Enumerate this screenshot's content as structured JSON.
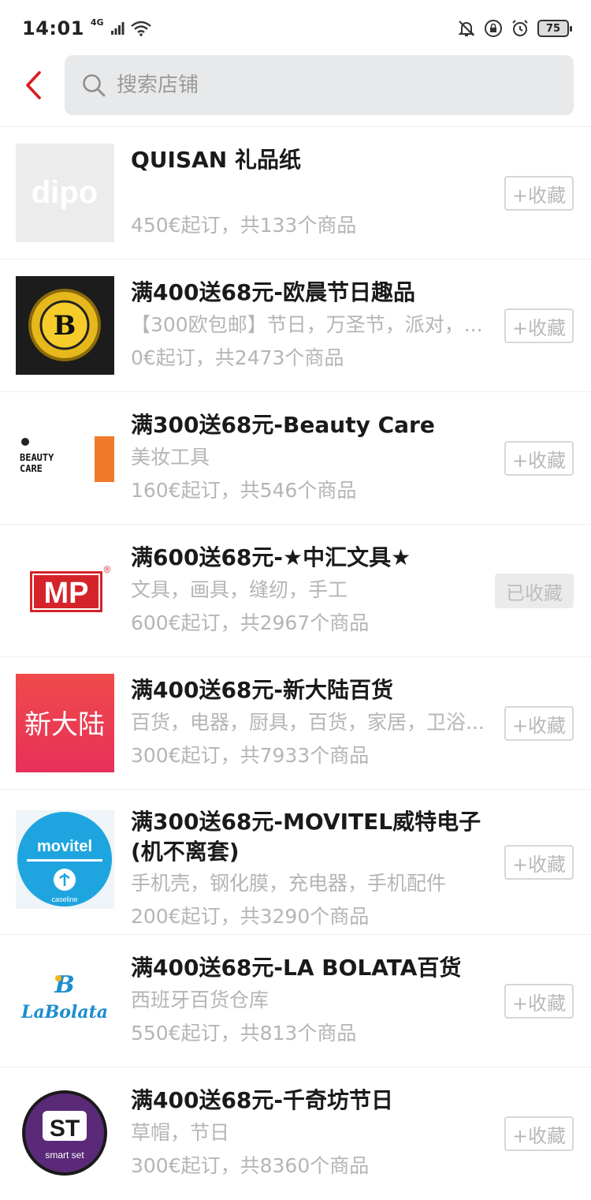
{
  "status": {
    "time": "14:01",
    "network": "4G",
    "battery": "75"
  },
  "search": {
    "placeholder": "搜索店铺"
  },
  "shops": [
    {
      "name": "QUISAN 礼品纸",
      "desc": "",
      "meta": "450€起订，共133个商品",
      "fav_label": "+收藏",
      "favorited": false,
      "logo_text": "dipo"
    },
    {
      "name": "满400送68元-欧晨节日趣品",
      "desc": "【300欧包邮】节日，万圣节，派对，...",
      "meta": "0€起订，共2473个商品",
      "fav_label": "+收藏",
      "favorited": false,
      "logo_text": "B"
    },
    {
      "name": "满300送68元-Beauty Care",
      "desc": "美妆工具",
      "meta": "160€起订，共546个商品",
      "fav_label": "+收藏",
      "favorited": false,
      "logo_text": "BEAUTY CARE"
    },
    {
      "name": "满600送68元-★中汇文具★",
      "desc": "文具，画具，缝纫，手工",
      "meta": "600€起订，共2967个商品",
      "fav_label": "已收藏",
      "favorited": true,
      "logo_text": "MP"
    },
    {
      "name": "满400送68元-新大陆百货",
      "desc": "百货，电器，厨具，百货，家居，卫浴...",
      "meta": "300€起订，共7933个商品",
      "fav_label": "+收藏",
      "favorited": false,
      "logo_text": "新大陆"
    },
    {
      "name": "满300送68元-MOVITEL威特电子(机不离套)",
      "desc": "手机壳，钢化膜，充电器，手机配件",
      "meta": "200€起订，共3290个商品",
      "fav_label": "+收藏",
      "favorited": false,
      "logo_text": "movitel"
    },
    {
      "name": "满400送68元-LA BOLATA百货",
      "desc": "西班牙百货仓库",
      "meta": "550€起订，共813个商品",
      "fav_label": "+收藏",
      "favorited": false,
      "logo_text": "LaBolata"
    },
    {
      "name": "满400送68元-千奇坊节日",
      "desc": "草帽，节日",
      "meta": "300€起订，共8360个商品",
      "fav_label": "+收藏",
      "favorited": false,
      "logo_text": "ST smart set"
    }
  ],
  "colors": {
    "accent": "#d81e1e",
    "muted_text": "#b5b5b5",
    "search_bg": "#e8e9eb"
  }
}
